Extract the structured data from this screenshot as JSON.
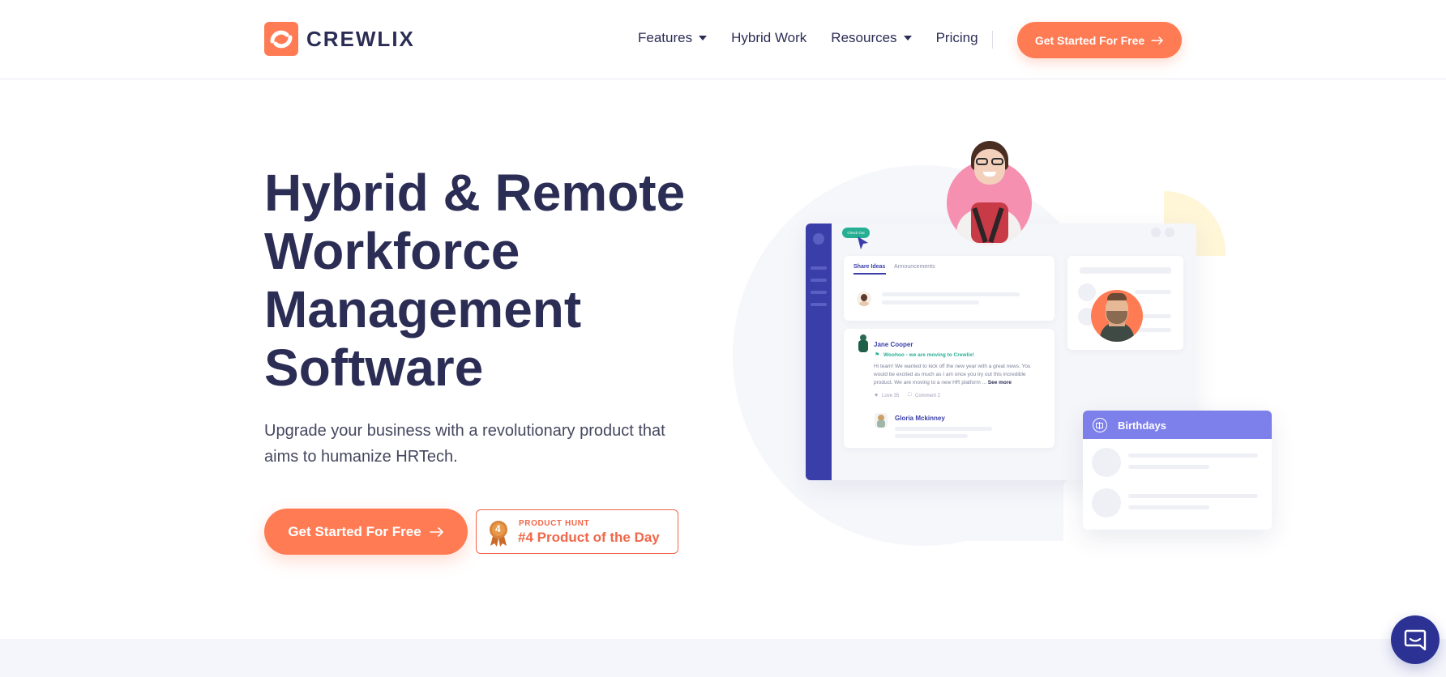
{
  "brand": {
    "name": "CREWLIX",
    "accent": "#ff7b54",
    "navy": "#2b2d55",
    "indigo": "#3a3ea8"
  },
  "nav": {
    "items": [
      {
        "label": "Features",
        "dropdown": true
      },
      {
        "label": "Hybrid Work",
        "dropdown": false
      },
      {
        "label": "Resources",
        "dropdown": true
      },
      {
        "label": "Pricing",
        "dropdown": false
      }
    ],
    "cta": "Get Started For Free"
  },
  "hero": {
    "title_lines": [
      "Hybrid & Remote",
      "Workforce",
      "Management",
      "Software"
    ],
    "subtitle": "Upgrade your business with a revolutionary product that aims to humanize HRTech.",
    "cta": "Get Started For Free",
    "badge": {
      "rank": "4",
      "small": "PRODUCT HUNT",
      "big": "#4 Product of the Day"
    }
  },
  "mockup": {
    "share_pill": "Check Out",
    "tabs": [
      "Share Ideas",
      "Announcements"
    ],
    "post": {
      "author": "Jane Cooper",
      "headline": "Woohoo - we are moving to Crewlix!",
      "body": "Hi team! We wanted to kick off the new year with a great news. You would be excited as much as I am once you try out this incredible product. We are moving to a new HR platform ...",
      "see_more": "See more",
      "love": "Love 35",
      "comment": "Comment 2"
    },
    "reply_author": "Gloria Mckinney",
    "birthdays_title": "Birthdays"
  },
  "icons": [
    "logo-icon",
    "caret-down-icon",
    "arrow-right-icon",
    "medal-icon",
    "cursor-icon",
    "gift-icon",
    "chat-icon"
  ]
}
